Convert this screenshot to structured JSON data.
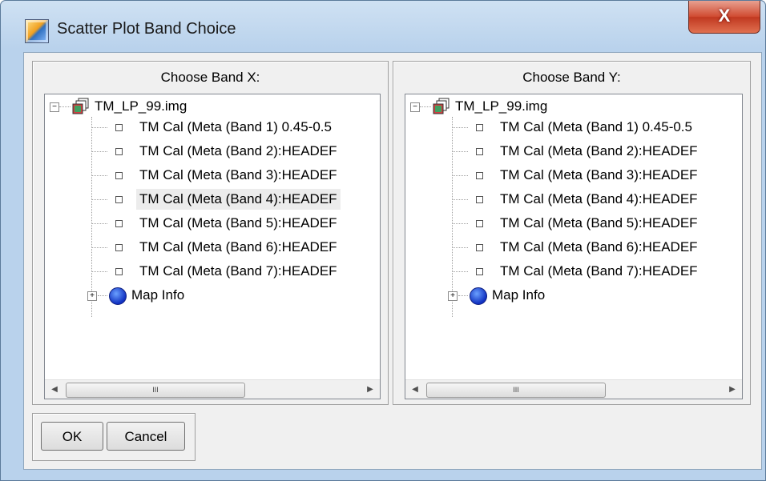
{
  "window": {
    "title": "Scatter Plot Band Choice",
    "close_label": "X"
  },
  "left_panel": {
    "title": "Choose Band X:",
    "root": "TM_LP_99.img",
    "bands": [
      "TM Cal (Meta (Band 1)  0.45-0.5",
      "TM Cal (Meta (Band 2):HEADEF",
      "TM Cal (Meta (Band 3):HEADEF",
      "TM Cal (Meta (Band 4):HEADEF",
      "TM Cal (Meta (Band 5):HEADEF",
      "TM Cal (Meta (Band 6):HEADEF",
      "TM Cal (Meta (Band 7):HEADEF"
    ],
    "selected_band_index": 3,
    "map_info": "Map Info",
    "scroll_thumb_grip": "III"
  },
  "right_panel": {
    "title": "Choose Band Y:",
    "root": "TM_LP_99.img",
    "bands": [
      "TM Cal (Meta (Band 1)  0.45-0.5",
      "TM Cal (Meta (Band 2):HEADEF",
      "TM Cal (Meta (Band 3):HEADEF",
      "TM Cal (Meta (Band 4):HEADEF",
      "TM Cal (Meta (Band 5):HEADEF",
      "TM Cal (Meta (Band 6):HEADEF",
      "TM Cal (Meta (Band 7):HEADEF"
    ],
    "map_info": "Map Info",
    "scroll_thumb_grip": "III"
  },
  "buttons": {
    "ok": "OK",
    "cancel": "Cancel"
  },
  "icons": {
    "app": "scatter-plot-app-icon",
    "image_file": "image-stack-icon",
    "map": "globe-icon"
  },
  "colors": {
    "close_button": "#d04a30",
    "title_bar": "#b9d2ec",
    "client_bg": "#f0f0f0"
  }
}
